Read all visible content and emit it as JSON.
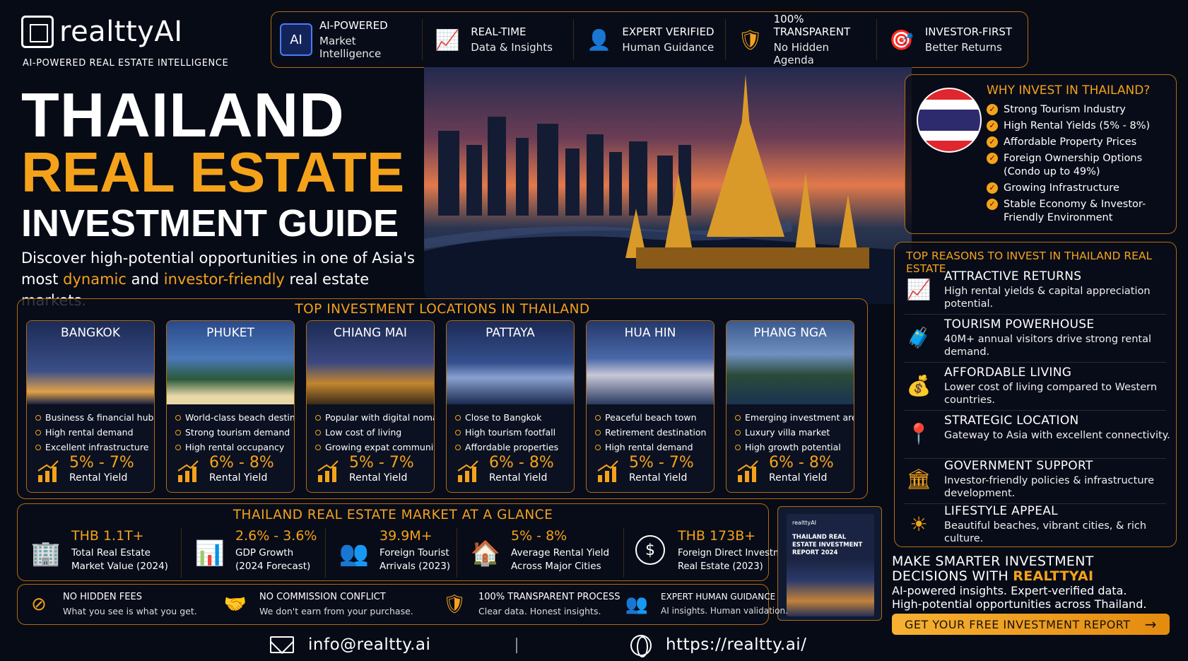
{
  "brand": {
    "name": "realttyAI",
    "tagline": "AI-POWERED REAL ESTATE INTELLIGENCE"
  },
  "features": [
    {
      "title": "AI-POWERED",
      "sub": "Market Intelligence",
      "icon": "ai-chip-icon",
      "glyph": "AI"
    },
    {
      "title": "REAL-TIME",
      "sub": "Data & Insights",
      "icon": "growth-chart-icon",
      "glyph": "📈"
    },
    {
      "title": "EXPERT VERIFIED",
      "sub": "Human Guidance",
      "icon": "expert-icon",
      "glyph": "👤"
    },
    {
      "title": "100% TRANSPARENT",
      "sub": "No Hidden Agenda",
      "icon": "shield-check-icon",
      "glyph": "🛡"
    },
    {
      "title": "INVESTOR-FIRST",
      "sub": "Better Returns",
      "icon": "target-icon",
      "glyph": "🎯"
    }
  ],
  "hero": {
    "line1": "THAILAND",
    "line2": "REAL ESTATE",
    "line3": "INVESTMENT GUIDE",
    "intro_a": "Discover high-potential opportunities in one of Asia's",
    "intro_b": "most ",
    "intro_c": "dynamic",
    "intro_d": " and ",
    "intro_e": "investor-friendly",
    "intro_f": " real estate markets."
  },
  "why": {
    "title": "WHY INVEST IN THAILAND?",
    "items": [
      "Strong Tourism Industry",
      "High Rental Yields (5% - 8%)",
      "Affordable Property Prices",
      "Foreign Ownership Options (Condo up to 49%)",
      "Growing Infrastructure",
      "Stable Economy & Investor-Friendly Environment"
    ]
  },
  "locations": {
    "title": "TOP INVESTMENT LOCATIONS IN THAILAND",
    "yield_label": "Rental Yield",
    "items": [
      {
        "name": "BANGKOK",
        "points": [
          "Business & financial hub",
          "High rental demand",
          "Excellent infrastructure"
        ],
        "yield": "5% - 7%"
      },
      {
        "name": "PHUKET",
        "points": [
          "World-class beach destination",
          "Strong tourism demand",
          "High rental occupancy"
        ],
        "yield": "6% - 8%"
      },
      {
        "name": "CHIANG MAI",
        "points": [
          "Popular with digital nomads",
          "Low cost of living",
          "Growing expat community"
        ],
        "yield": "5% - 7%"
      },
      {
        "name": "PATTAYA",
        "points": [
          "Close to Bangkok",
          "High tourism footfall",
          "Affordable properties"
        ],
        "yield": "6% - 8%"
      },
      {
        "name": "HUA HIN",
        "points": [
          "Peaceful beach town",
          "Retirement destination",
          "High rental demand"
        ],
        "yield": "5% - 7%"
      },
      {
        "name": "PHANG NGA",
        "points": [
          "Emerging investment area",
          "Luxury villa market",
          "High growth potential"
        ],
        "yield": "6% - 8%"
      }
    ]
  },
  "reasons": {
    "title": "TOP REASONS TO INVEST IN THAILAND REAL ESTATE",
    "items": [
      {
        "title": "ATTRACTIVE RETURNS",
        "desc": "High rental yields & capital appreciation potential.",
        "icon": "bar-chart-icon",
        "glyph": "📈"
      },
      {
        "title": "TOURISM POWERHOUSE",
        "desc": "40M+ annual visitors drive strong rental demand.",
        "icon": "tourist-icon",
        "glyph": "🧳"
      },
      {
        "title": "AFFORDABLE LIVING",
        "desc": "Lower cost of living compared to Western countries.",
        "icon": "money-bag-icon",
        "glyph": "💰"
      },
      {
        "title": "STRATEGIC LOCATION",
        "desc": "Gateway to Asia with excellent connectivity.",
        "icon": "map-pin-icon",
        "glyph": "📍"
      },
      {
        "title": "GOVERNMENT SUPPORT",
        "desc": "Investor-friendly policies & infrastructure development.",
        "icon": "government-icon",
        "glyph": "🏛"
      },
      {
        "title": "LIFESTYLE APPEAL",
        "desc": "Beautiful beaches, vibrant cities, & rich culture.",
        "icon": "sun-icon",
        "glyph": "☀"
      }
    ]
  },
  "glance": {
    "title": "THAILAND REAL ESTATE MARKET AT A GLANCE",
    "stats": [
      {
        "value": "THB 1.1T+",
        "label1": "Total Real Estate",
        "label2": "Market Value (2024)",
        "icon": "buildings-icon",
        "glyph": "🏢"
      },
      {
        "value": "2.6% - 3.6%",
        "label1": "GDP Growth",
        "label2": "(2024 Forecast)",
        "icon": "gdp-chart-icon",
        "glyph": "📊"
      },
      {
        "value": "39.9M+",
        "label1": "Foreign Tourist",
        "label2": "Arrivals (2023)",
        "icon": "people-icon",
        "glyph": "👥"
      },
      {
        "value": "5% - 8%",
        "label1": "Average Rental Yield",
        "label2": "Across Major Cities",
        "icon": "house-icon",
        "glyph": "🏠"
      },
      {
        "value": "THB 173B+",
        "label1": "Foreign Direct Investment in",
        "label2": "Real Estate (2023)",
        "icon": "dollar-icon",
        "glyph": "$"
      }
    ]
  },
  "report": {
    "brand": "realttyAI",
    "title": "THAILAND REAL ESTATE INVESTMENT REPORT 2024"
  },
  "cta": {
    "heading_a": "MAKE SMARTER INVESTMENT",
    "heading_b": "DECISIONS WITH ",
    "heading_brand": "REALTTYAI",
    "desc_a": "AI-powered insights. Expert-verified data.",
    "desc_b": "High-potential opportunities across Thailand.",
    "button": "GET YOUR FREE INVESTMENT REPORT",
    "arrow": "→"
  },
  "trust": [
    {
      "title": "NO HIDDEN FEES",
      "desc": "What you see is what you get.",
      "icon": "no-fees-icon",
      "glyph": "⊘"
    },
    {
      "title": "NO COMMISSION CONFLICT",
      "desc": "We don't earn from your purchase.",
      "icon": "handshake-icon",
      "glyph": "🤝"
    },
    {
      "title": "100% TRANSPARENT PROCESS",
      "desc": "Clear data. Honest insights.",
      "icon": "shield-icon",
      "glyph": "🛡"
    },
    {
      "title": "EXPERT HUMAN GUIDANCE",
      "desc": "AI insights. Human validation.",
      "icon": "advisor-icon",
      "glyph": "👥"
    }
  ],
  "footer": {
    "email": "info@realtty.ai",
    "website": "https://realtty.ai/"
  },
  "colors": {
    "accent": "#f5a21b",
    "background": "#070b16",
    "border": "#b36a12"
  }
}
